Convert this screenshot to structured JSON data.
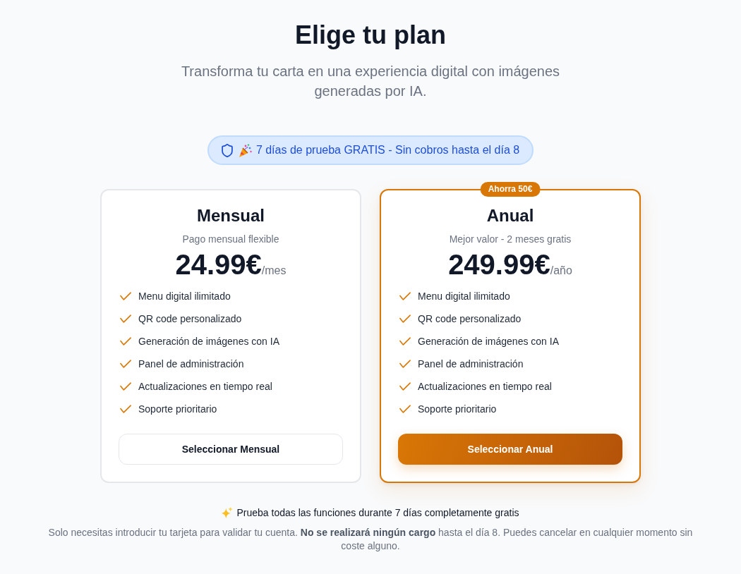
{
  "header": {
    "title": "Elige tu plan",
    "subtitle": "Transforma tu carta en una experiencia digital con imágenes generadas por IA."
  },
  "trial_banner": {
    "text": "7 días de prueba GRATIS - Sin cobros hasta el día 8"
  },
  "plans": [
    {
      "name": "Mensual",
      "tagline": "Pago mensual flexible",
      "price": "24.99€",
      "period": "/mes",
      "highlighted": false,
      "features": [
        "Menu digital ilimitado",
        "QR code personalizado",
        "Generación de imágenes con IA",
        "Panel de administración",
        "Actualizaciones en tiempo real",
        "Soporte prioritario"
      ],
      "button": "Seleccionar Mensual"
    },
    {
      "name": "Anual",
      "badge": "Ahorra 50€",
      "tagline": "Mejor valor - 2 meses gratis",
      "price": "249.99€",
      "period": "/año",
      "highlighted": true,
      "features": [
        "Menu digital ilimitado",
        "QR code personalizado",
        "Generación de imágenes con IA",
        "Panel de administración",
        "Actualizaciones en tiempo real",
        "Soporte prioritario"
      ],
      "button": "Seleccionar Anual"
    }
  ],
  "footer": {
    "headline": "Prueba todas las funciones durante 7 días completamente gratis",
    "note": "Solo necesitas introducir tu tarjeta para validar tu cuenta. **No se realizará ningún cargo** hasta el día 8. Puedes cancelar en cualquier momento sin coste alguno."
  }
}
